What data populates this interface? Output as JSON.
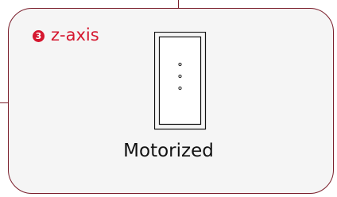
{
  "colors": {
    "accent": "#d5172f",
    "outline": "#7a1e2b",
    "panel_background": "#f5f5f5",
    "text": "#111111"
  },
  "panel": {
    "badge_number": "3",
    "axis_label": "z-axis",
    "device_icon": "motorized-stage-icon",
    "caption": "Motorized"
  }
}
